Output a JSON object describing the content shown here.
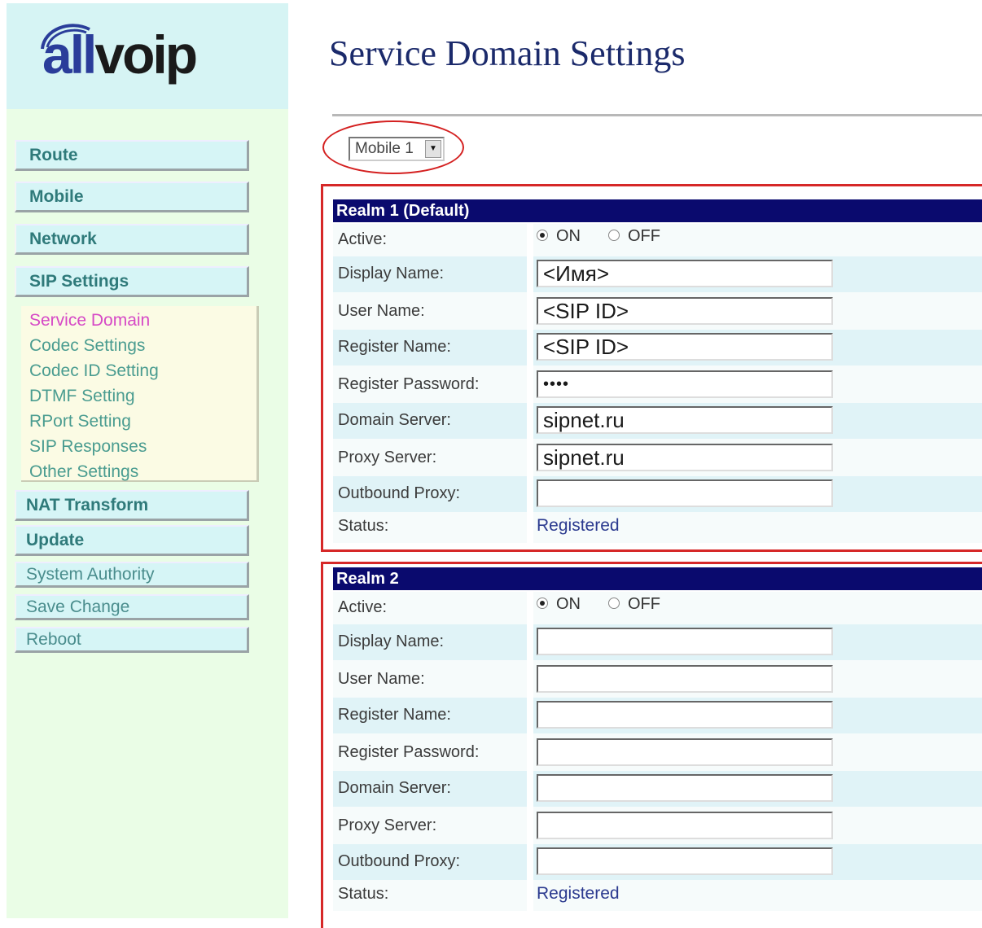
{
  "logo": {
    "text_a": "all",
    "text_b": "voip"
  },
  "page_title": "Service Domain Settings",
  "nav": {
    "route": "Route",
    "mobile": "Mobile",
    "network": "Network",
    "sip_settings": "SIP Settings",
    "sub": [
      "Service Domain",
      "Codec Settings",
      "Codec ID Setting",
      "DTMF Setting",
      "RPort Setting",
      "SIP Responses",
      "Other Settings"
    ],
    "nat_transform": "NAT Transform",
    "update": "Update",
    "system_authority": "System Authority",
    "save_change": "Save Change",
    "reboot": "Reboot"
  },
  "mobile_select": {
    "value": "Mobile 1"
  },
  "labels": {
    "active": "Active:",
    "display_name": "Display Name:",
    "user_name": "User Name:",
    "register_name": "Register Name:",
    "register_password": "Register Password:",
    "domain_server": "Domain Server:",
    "proxy_server": "Proxy Server:",
    "outbound_proxy": "Outbound Proxy:",
    "status": "Status:",
    "on": "ON",
    "off": "OFF"
  },
  "realm1": {
    "title": "Realm 1 (Default)",
    "active": "ON",
    "display_name": "<Имя>",
    "user_name": "<SIP ID>",
    "register_name": "<SIP ID>",
    "register_password": "••••",
    "domain_server": "sipnet.ru",
    "proxy_server": "sipnet.ru",
    "outbound_proxy": "",
    "status": "Registered"
  },
  "realm2": {
    "title": "Realm 2",
    "active": "ON",
    "display_name": "",
    "user_name": "",
    "register_name": "",
    "register_password": "",
    "domain_server": "",
    "proxy_server": "",
    "outbound_proxy": "",
    "status": "Registered"
  },
  "colors": {
    "sidebar_bg": "#eafde6",
    "logo_bg": "#d6f4f4",
    "header_bg": "#0a0a6e",
    "highlight_red": "#d62828",
    "active_sub": "#d649c6"
  }
}
